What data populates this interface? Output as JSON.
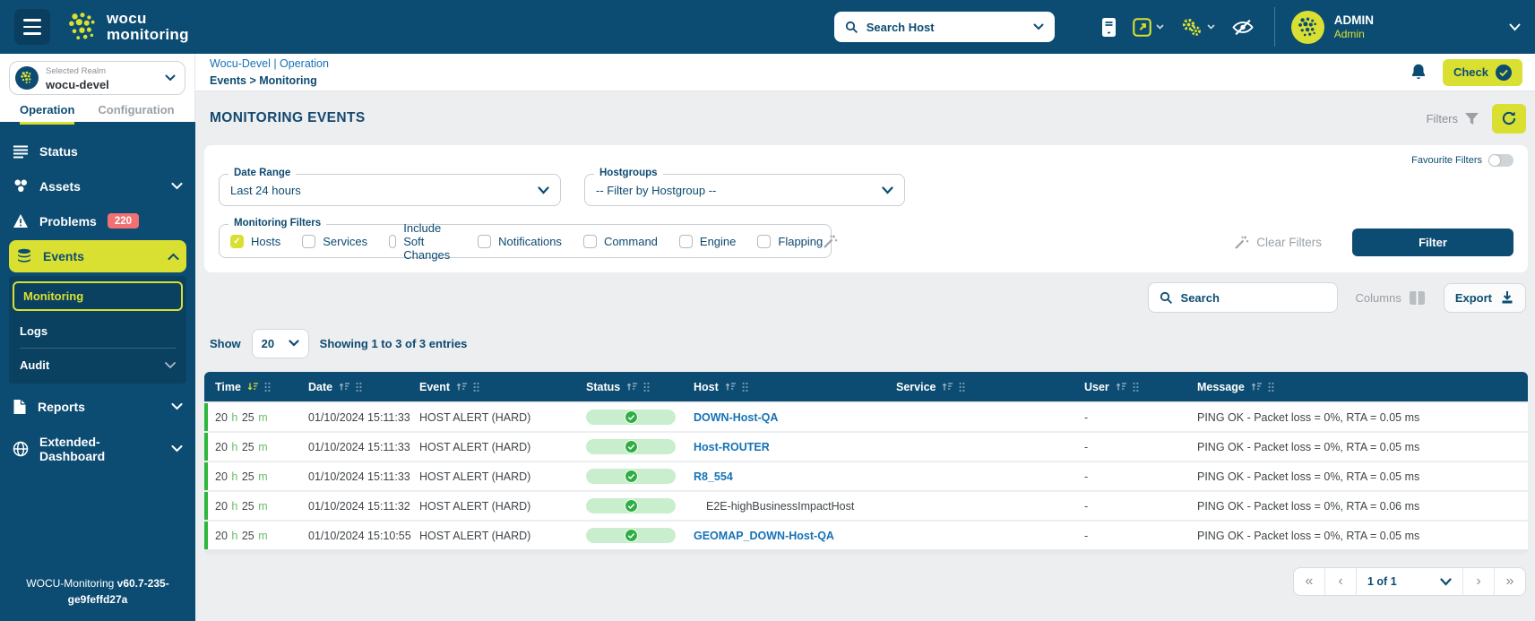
{
  "colors": {
    "navy": "#0c4c72",
    "accent": "#d9e032",
    "link_blue": "#1572b6",
    "badge_red": "#f17173",
    "row_green": "#2db83d",
    "pill_green_bg": "#c8eecd",
    "pill_green": "#2fae43"
  },
  "brand": {
    "line1": "wocu",
    "line2": "monitoring"
  },
  "navbar": {
    "search": {
      "placeholder": "Search Host"
    },
    "user": {
      "name": "ADMIN",
      "role": "Admin"
    }
  },
  "sidebar": {
    "realm": {
      "label": "Selected Realm",
      "value": "wocu-devel"
    },
    "tabs": [
      {
        "label": "Operation"
      },
      {
        "label": "Configuration"
      }
    ],
    "items": [
      {
        "label": "Status"
      },
      {
        "label": "Assets"
      },
      {
        "label": "Problems",
        "badge": "220"
      },
      {
        "label": "Events"
      },
      {
        "label": "Reports"
      },
      {
        "label": "Extended-Dashboard"
      }
    ],
    "events_submenu": [
      {
        "label": "Monitoring"
      },
      {
        "label": "Logs"
      },
      {
        "label": "Audit"
      }
    ],
    "version_prefix": "WOCU-Monitoring",
    "version": "v60.7-235-ge9feffd27a"
  },
  "header": {
    "breadcrumb_line1": "Wocu-Devel | Operation",
    "breadcrumb_line2": "Events > Monitoring",
    "check_button": "Check"
  },
  "page": {
    "title": "MONITORING EVENTS",
    "filters_label": "Filters",
    "favourite_filters_label": "Favourite Filters"
  },
  "filters": {
    "date_range": {
      "label": "Date Range",
      "value": "Last 24 hours"
    },
    "hostgroups": {
      "label": "Hostgroups",
      "value": "-- Filter by Hostgroup --"
    },
    "monitoring": {
      "label": "Monitoring Filters",
      "options": [
        {
          "label": "Hosts",
          "checked": true
        },
        {
          "label": "Services",
          "checked": false
        },
        {
          "label": "Include Soft Changes",
          "checked": false
        },
        {
          "label": "Notifications",
          "checked": false
        },
        {
          "label": "Command",
          "checked": false
        },
        {
          "label": "Engine",
          "checked": false
        },
        {
          "label": "Flapping",
          "checked": false
        }
      ]
    },
    "clear_label": "Clear Filters",
    "apply_label": "Filter"
  },
  "toolbar": {
    "search_placeholder": "Search",
    "columns_label": "Columns",
    "export_label": "Export"
  },
  "list_controls": {
    "show_label": "Show",
    "page_size": "20",
    "showing_text": "Showing 1 to 3 of 3 entries"
  },
  "table": {
    "columns": [
      {
        "label": "Time",
        "sort": "active-desc"
      },
      {
        "label": "Date",
        "sort": "default"
      },
      {
        "label": "Event",
        "sort": "default"
      },
      {
        "label": "Status",
        "sort": "default"
      },
      {
        "label": "Host",
        "sort": "default"
      },
      {
        "label": "Service",
        "sort": "default"
      },
      {
        "label": "User",
        "sort": "default"
      },
      {
        "label": "Message",
        "sort": "default"
      }
    ],
    "rows": [
      {
        "time": "20 h 25 m",
        "date": "01/10/2024 15:11:33",
        "event": "HOST ALERT (HARD)",
        "status": "up",
        "host": "DOWN-Host-QA",
        "host_link": true,
        "service": "",
        "user": "-",
        "message": "PING OK - Packet loss = 0%, RTA = 0.05 ms"
      },
      {
        "time": "20 h 25 m",
        "date": "01/10/2024 15:11:33",
        "event": "HOST ALERT (HARD)",
        "status": "up",
        "host": "Host-ROUTER",
        "host_link": true,
        "service": "",
        "user": "-",
        "message": "PING OK - Packet loss = 0%, RTA = 0.05 ms"
      },
      {
        "time": "20 h 25 m",
        "date": "01/10/2024 15:11:33",
        "event": "HOST ALERT (HARD)",
        "status": "up",
        "host": "R8_554",
        "host_link": true,
        "service": "",
        "user": "-",
        "message": "PING OK - Packet loss = 0%, RTA = 0.05 ms"
      },
      {
        "time": "20 h 25 m",
        "date": "01/10/2024 15:11:32",
        "event": "HOST ALERT (HARD)",
        "status": "up",
        "host": "E2E-highBusinessImpactHost",
        "host_link": false,
        "service": "",
        "user": "-",
        "message": "PING OK - Packet loss = 0%, RTA = 0.06 ms"
      },
      {
        "time": "20 h 25 m",
        "date": "01/10/2024 15:10:55",
        "event": "HOST ALERT (HARD)",
        "status": "up",
        "host": "GEOMAP_DOWN-Host-QA",
        "host_link": true,
        "service": "",
        "user": "-",
        "message": "PING OK - Packet loss = 0%, RTA = 0.05 ms"
      }
    ]
  },
  "pagination": {
    "label": "1 of 1"
  }
}
